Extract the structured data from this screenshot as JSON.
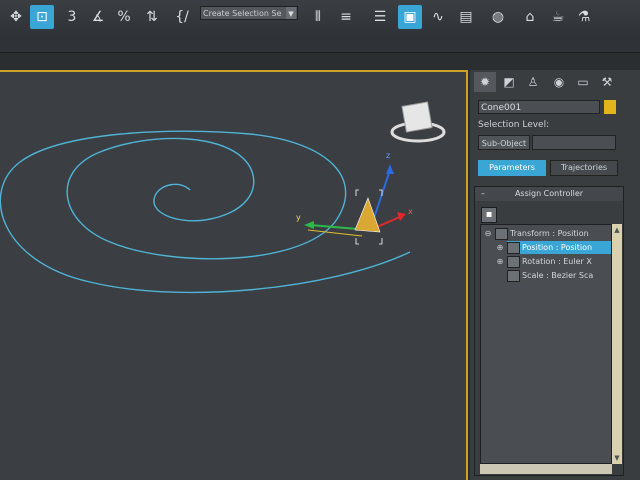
{
  "toolbar": {
    "icons": [
      {
        "name": "move-icon",
        "glyph": "✥",
        "active": false
      },
      {
        "name": "select-and-place-icon",
        "glyph": "⊡",
        "active": true
      },
      {
        "name": "snaps-3-icon",
        "glyph": "3",
        "active": false
      },
      {
        "name": "angle-snap-icon",
        "glyph": "∡",
        "active": false
      },
      {
        "name": "percent-snap-icon",
        "glyph": "%",
        "active": false
      },
      {
        "name": "spinner-snap-icon",
        "glyph": "⇅",
        "active": false
      },
      {
        "name": "edit-named-selection-icon",
        "glyph": "{/",
        "active": false
      },
      {
        "name": "mirror-icon",
        "glyph": "⫴",
        "active": false
      },
      {
        "name": "align-icon",
        "glyph": "≡",
        "active": false
      },
      {
        "name": "layer-manager-icon",
        "glyph": "☰",
        "active": false
      },
      {
        "name": "scene-explorer-icon",
        "glyph": "▣",
        "active": true
      },
      {
        "name": "curve-editor-icon",
        "glyph": "∿",
        "active": false
      },
      {
        "name": "schematic-view-icon",
        "glyph": "▤",
        "active": false
      },
      {
        "name": "material-editor-icon",
        "glyph": "◍",
        "active": false
      },
      {
        "name": "render-setup-icon",
        "glyph": "⌂",
        "active": false
      },
      {
        "name": "rendered-frame-icon",
        "glyph": "☕",
        "active": false
      },
      {
        "name": "render-icon",
        "glyph": "⚗",
        "active": false
      }
    ],
    "selection_set_placeholder": "Create Selection Se"
  },
  "panel": {
    "tabs": [
      {
        "name": "create-tab-icon",
        "glyph": "✹"
      },
      {
        "name": "modify-tab-icon",
        "glyph": "◩"
      },
      {
        "name": "hierarchy-tab-icon",
        "glyph": "♙"
      },
      {
        "name": "motion-tab-icon",
        "glyph": "◉"
      },
      {
        "name": "display-tab-icon",
        "glyph": "▭"
      },
      {
        "name": "utilities-tab-icon",
        "glyph": "⚒"
      }
    ],
    "object_name": "Cone001",
    "object_color": "#e3b41c",
    "selection_level_label": "Selection Level:",
    "sub_object_label": "Sub-Object",
    "tab_parameters": "Parameters",
    "tab_trajectories": "Trajectories",
    "rollout_title": "Assign Controller",
    "rollout_toggle": "–",
    "tree": [
      {
        "label": "Transform : Position",
        "selected": false,
        "level": 0,
        "expander": "⊖"
      },
      {
        "label": "Position : Position",
        "selected": true,
        "level": 1,
        "expander": "⊕"
      },
      {
        "label": "Rotation : Euler X",
        "selected": false,
        "level": 1,
        "expander": "⊕"
      },
      {
        "label": "Scale : Bezier Sca",
        "selected": false,
        "level": 1,
        "expander": ""
      }
    ]
  },
  "viewport": {
    "gizmo_axes": {
      "x": "x",
      "y": "y",
      "z": "z"
    },
    "spline_color": "#4fb3d6",
    "accent_border": "#c9a227"
  }
}
